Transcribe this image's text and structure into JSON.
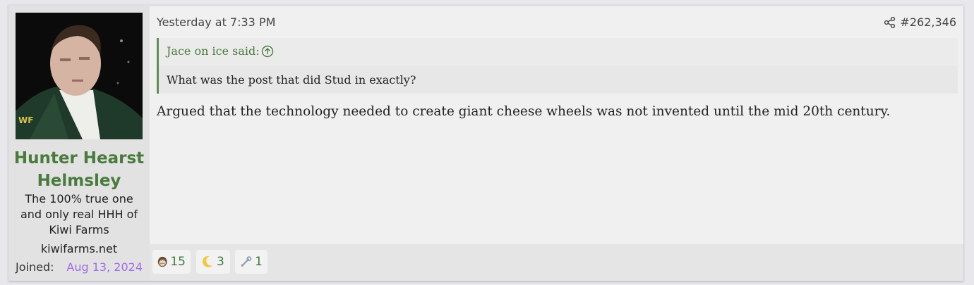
{
  "user": {
    "name_line1": "Hunter Hearst",
    "name_line2": "Helmsley",
    "title": "The 100% true one and only real HHH of Kiwi Farms",
    "banner": "kiwifarms.net",
    "joined_label": "Joined:",
    "joined_date": "Aug 13, 2024"
  },
  "post": {
    "timestamp": "Yesterday at 7:33 PM",
    "number": "#262,346",
    "quote": {
      "author": "Jace on ice said:",
      "text": "What was the post that did Stud in exactly?"
    },
    "body": "Argued that the technology needed to create giant cheese wheels was not invented until the mid 20th century."
  },
  "reactions": [
    {
      "icon": "monkey-face-icon",
      "count": "15"
    },
    {
      "icon": "crescent-moon-icon",
      "count": "3"
    },
    {
      "icon": "wrench-icon",
      "count": "1"
    }
  ],
  "colors": {
    "username": "#4a7a3e",
    "joined_date": "#a26be8",
    "quote_border": "#5e9052"
  }
}
